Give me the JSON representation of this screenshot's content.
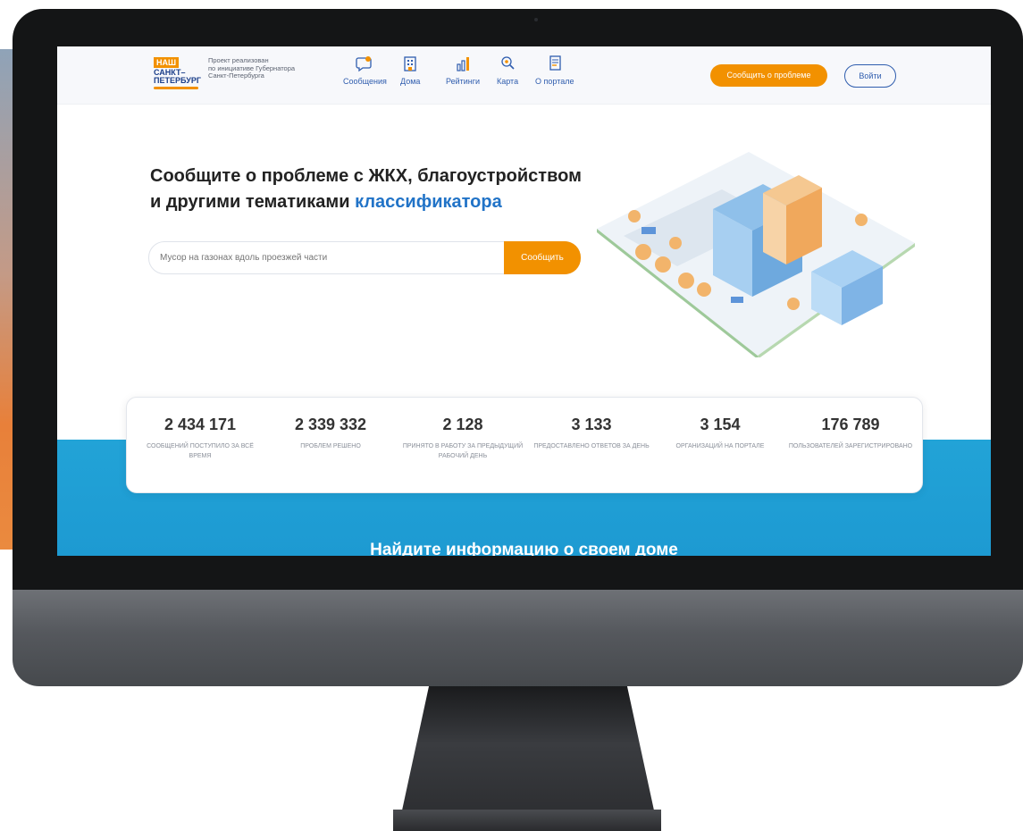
{
  "header": {
    "logo": {
      "nash": "НАШ",
      "city_line1": "САНКТ–",
      "city_line2": "ПЕТЕРБУРГ"
    },
    "project_text": [
      "Проект реализован",
      "по инициативе Губернатора",
      "Санкт-Петербурга"
    ],
    "nav": [
      {
        "label": "Сообщения",
        "icon": "speech-bubble-icon"
      },
      {
        "label": "Дома",
        "icon": "building-icon"
      },
      {
        "label": "Рейтинги",
        "icon": "bar-chart-icon"
      },
      {
        "label": "Карта",
        "icon": "map-search-icon"
      },
      {
        "label": "О портале",
        "icon": "document-icon"
      }
    ],
    "report_button": "Сообщить о проблеме",
    "login_button": "Войти"
  },
  "hero": {
    "title_line1": "Сообщите о проблеме с ЖКХ, благоустройством",
    "title_line2_prefix": "и другими тематиками ",
    "title_line2_accent": "классификатора",
    "search_placeholder": "Мусор на газонах вдоль проезжей части",
    "search_button": "Сообщить"
  },
  "stats": [
    {
      "value": "2 434 171",
      "label": "сообщений поступило за всё время"
    },
    {
      "value": "2 339 332",
      "label": "проблем решено"
    },
    {
      "value": "2 128",
      "label": "принято в работу за предыдущий рабочий день"
    },
    {
      "value": "3 133",
      "label": "предоставлено ответов за день"
    },
    {
      "value": "3 154",
      "label": "организаций на портале"
    },
    {
      "value": "176 789",
      "label": "пользователей зарегистрировано"
    }
  ],
  "find_section_title": "Найдите информацию о своем доме",
  "colors": {
    "accent_orange": "#f29100",
    "brand_blue": "#2173c7",
    "band_blue": "#22a3d7"
  }
}
